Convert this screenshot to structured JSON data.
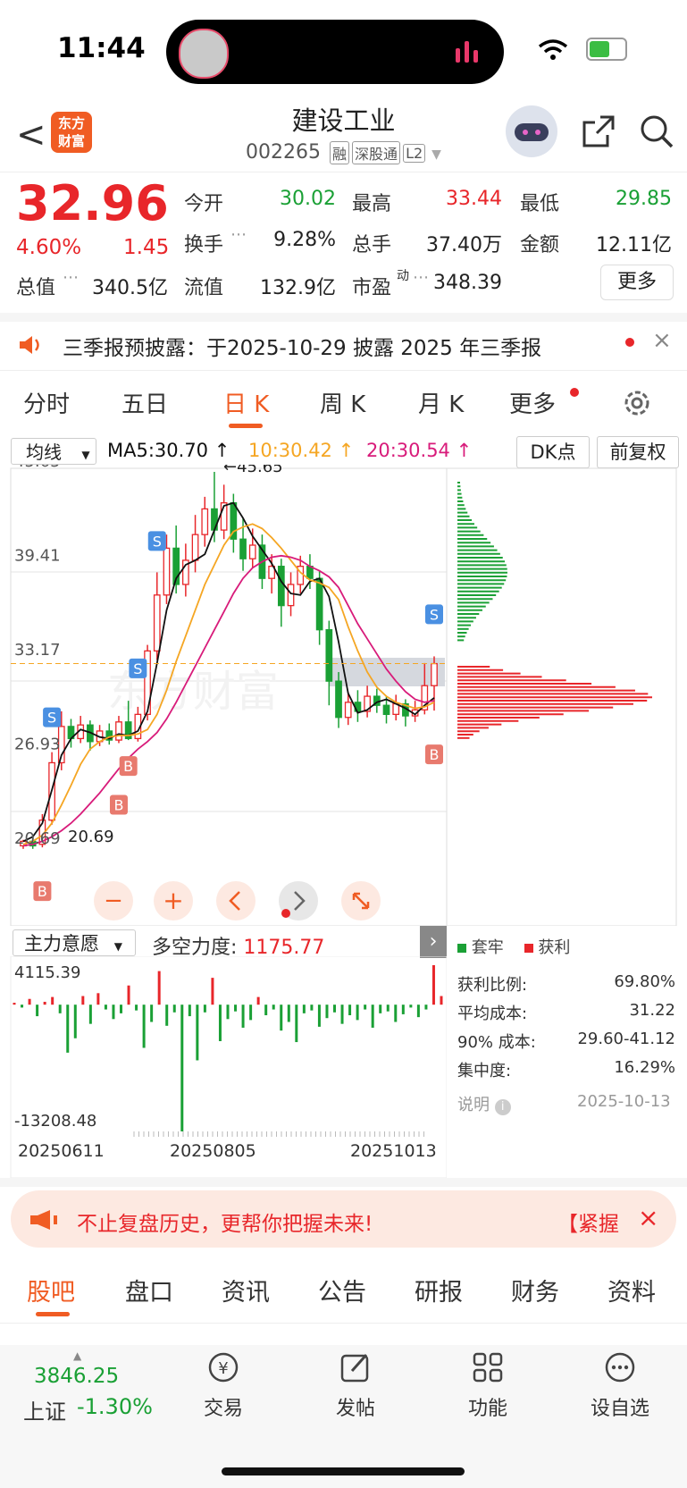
{
  "status_bar": {
    "time": "11:44"
  },
  "header": {
    "back_glyph": "<",
    "logo_line1": "东方",
    "logo_line2": "财富",
    "stock_name": "建设工业",
    "stock_code": "002265",
    "tags": [
      "融",
      "深股通",
      "L2"
    ]
  },
  "quote": {
    "price": "32.96",
    "change_pct": "4.60%",
    "change": "1.45",
    "fields": [
      {
        "label": "今开",
        "value": "30.02",
        "color": "#1aa035"
      },
      {
        "label": "最高",
        "value": "33.44",
        "color": "#e8262a"
      },
      {
        "label": "最低",
        "value": "29.85",
        "color": "#1aa035"
      },
      {
        "label": "换手",
        "value": "9.28%",
        "color": "#222222"
      },
      {
        "label": "总手",
        "value": "37.40万",
        "color": "#222222"
      },
      {
        "label": "金额",
        "value": "12.11亿",
        "color": "#222222"
      },
      {
        "label": "总值",
        "value": "340.5亿",
        "color": "#222222"
      },
      {
        "label": "流值",
        "value": "132.9亿",
        "color": "#222222"
      },
      {
        "label": "市盈",
        "value": "348.39",
        "color": "#222222"
      }
    ],
    "pe_superscript": "动",
    "more_label": "更多"
  },
  "notice": {
    "text": "三季报预披露：于2025-10-29 披露 2025 年三季报",
    "close": "×"
  },
  "kline_tabs": [
    "分时",
    "五日",
    "日 K",
    "周 K",
    "月 K",
    "更多"
  ],
  "chart_toolbar": {
    "indicator": "均线",
    "ma5": "MA5:30.70 ↑",
    "ma10": "10:30.42 ↑",
    "ma20": "20:30.54 ↑",
    "dk_label": "DK点",
    "adjust_label": "前复权"
  },
  "chart_data": [
    {
      "type": "candlestick",
      "title": "",
      "y_ticks": [
        "45.65",
        "39.41",
        "33.17",
        "26.93",
        "20.69"
      ],
      "ylim": [
        20.69,
        45.65
      ],
      "max_label": "←45.65",
      "min_label": "20.69",
      "current_price": 32.96,
      "x_ticks": [
        "20250611",
        "20250805",
        "20251013"
      ],
      "series": [
        {
          "name": "MA5",
          "color": "#111111",
          "values": [
            21.2,
            21.5,
            22.4,
            24.6,
            26.9,
            28.0,
            28.6,
            28.4,
            28.1,
            28.0,
            28.3,
            28.2,
            28.5,
            29.8,
            33.0,
            36.5,
            38.6,
            39.5,
            39.8,
            40.2,
            41.8,
            43.4,
            43.6,
            42.6,
            41.4,
            40.5,
            39.6,
            38.4,
            37.6,
            37.5,
            38.4,
            38.6,
            37.4,
            34.4,
            31.0,
            29.7,
            29.9,
            30.4,
            30.6,
            30.3,
            30.0,
            29.6,
            30.2,
            30.7
          ]
        },
        {
          "name": "MA10",
          "color": "#f5a623",
          "values": [
            21.0,
            21.2,
            21.6,
            22.4,
            23.6,
            24.9,
            26.3,
            27.3,
            27.8,
            28.1,
            28.2,
            28.2,
            28.3,
            28.6,
            29.6,
            31.2,
            33.1,
            34.8,
            36.5,
            38.2,
            39.5,
            40.8,
            41.7,
            42.0,
            42.2,
            41.9,
            41.3,
            40.6,
            39.8,
            39.0,
            38.5,
            38.3,
            38.0,
            37.2,
            35.4,
            33.8,
            32.4,
            31.4,
            30.8,
            30.4,
            30.2,
            30.0,
            30.1,
            30.4
          ]
        },
        {
          "name": "MA20",
          "color": "#d81b7a",
          "values": [
            20.9,
            21.0,
            21.2,
            21.5,
            21.9,
            22.4,
            23.0,
            23.7,
            24.4,
            25.2,
            26.0,
            26.7,
            27.3,
            27.8,
            28.4,
            29.3,
            30.4,
            31.6,
            32.8,
            34.0,
            35.2,
            36.4,
            37.6,
            38.6,
            39.3,
            39.7,
            40.0,
            40.1,
            40.0,
            39.8,
            39.4,
            39.1,
            38.7,
            38.0,
            36.8,
            35.6,
            34.6,
            33.6,
            32.6,
            31.8,
            31.1,
            30.6,
            30.4,
            30.5
          ]
        }
      ],
      "candles": [
        [
          20.9,
          21.2,
          20.7,
          21.3
        ],
        [
          21.2,
          20.9,
          20.7,
          21.4
        ],
        [
          21.0,
          22.6,
          20.8,
          23.0
        ],
        [
          22.6,
          26.4,
          22.3,
          27.1
        ],
        [
          26.4,
          28.8,
          25.9,
          29.8
        ],
        [
          28.8,
          28.0,
          27.4,
          29.3
        ],
        [
          28.0,
          28.9,
          27.7,
          29.5
        ],
        [
          28.9,
          27.8,
          27.2,
          29.2
        ],
        [
          27.8,
          28.5,
          27.5,
          28.9
        ],
        [
          28.5,
          27.9,
          27.6,
          29.0
        ],
        [
          27.9,
          29.1,
          27.7,
          29.5
        ],
        [
          29.1,
          28.0,
          27.9,
          30.5
        ],
        [
          28.0,
          29.6,
          27.8,
          30.1
        ],
        [
          29.6,
          33.8,
          29.2,
          34.2
        ],
        [
          33.8,
          37.5,
          33.2,
          39.0
        ],
        [
          37.5,
          40.6,
          36.9,
          41.5
        ],
        [
          40.6,
          38.2,
          37.6,
          42.1
        ],
        [
          38.2,
          39.8,
          37.4,
          40.9
        ],
        [
          39.8,
          41.5,
          39.0,
          42.8
        ],
        [
          41.5,
          43.2,
          40.7,
          44.0
        ],
        [
          43.2,
          41.8,
          41.0,
          45.65
        ],
        [
          41.8,
          43.6,
          41.2,
          44.8
        ],
        [
          43.6,
          41.2,
          40.3,
          44.2
        ],
        [
          41.2,
          39.9,
          39.1,
          42.6
        ],
        [
          39.9,
          40.8,
          39.3,
          41.9
        ],
        [
          40.8,
          38.6,
          37.9,
          41.5
        ],
        [
          38.6,
          39.4,
          37.6,
          40.2
        ],
        [
          39.4,
          36.8,
          35.4,
          39.9
        ],
        [
          36.8,
          38.2,
          36.1,
          39.0
        ],
        [
          38.2,
          39.4,
          37.6,
          40.1
        ],
        [
          39.4,
          38.6,
          37.9,
          40.2
        ],
        [
          38.6,
          35.2,
          34.2,
          39.1
        ],
        [
          35.2,
          31.8,
          30.2,
          35.8
        ],
        [
          31.8,
          29.4,
          28.7,
          32.4
        ],
        [
          29.4,
          30.4,
          28.9,
          31.1
        ],
        [
          30.4,
          29.8,
          29.1,
          31.2
        ],
        [
          29.8,
          30.8,
          29.4,
          31.5
        ],
        [
          30.8,
          30.2,
          29.7,
          31.3
        ],
        [
          30.2,
          29.6,
          29.0,
          30.8
        ],
        [
          29.6,
          30.3,
          29.2,
          30.9
        ],
        [
          30.3,
          29.5,
          28.8,
          30.6
        ],
        [
          29.5,
          29.9,
          29.1,
          30.5
        ],
        [
          29.9,
          31.5,
          29.6,
          33.0
        ],
        [
          31.5,
          32.96,
          29.85,
          33.44
        ]
      ],
      "signals": [
        "S",
        "S",
        "S",
        "S",
        "B",
        "B",
        "B",
        "B"
      ]
    },
    {
      "type": "bar",
      "title": "",
      "indicator": "主力意愿",
      "label": "多空力度:",
      "value": "1175.77",
      "y_ticks": [
        "4115.39",
        "-13208.48"
      ],
      "ylim": [
        -13208.48,
        4115.39
      ],
      "values": [
        200,
        -300,
        600,
        -1200,
        300,
        800,
        -900,
        -5000,
        -3500,
        900,
        -2000,
        1200,
        -500,
        -1500,
        -900,
        2000,
        -600,
        -4500,
        -1800,
        3500,
        -2200,
        -800,
        -13208,
        -1200,
        -5800,
        -800,
        2800,
        -3800,
        -1500,
        -700,
        -2400,
        -1600,
        800,
        -1100,
        -500,
        -2700,
        -1800,
        -3900,
        -900,
        -600,
        -2300,
        -1400,
        -800,
        -2000,
        -1100,
        -1600,
        -500,
        -2400,
        -900,
        -700,
        -1800,
        -1000,
        -300,
        -1300,
        -500,
        4115,
        900
      ]
    }
  ],
  "chip": {
    "legend_locked": "套牢",
    "legend_profit": "获利",
    "rows": [
      {
        "label": "获利比例:",
        "value": "69.80%"
      },
      {
        "label": "平均成本:",
        "value": "31.22"
      },
      {
        "label": "90% 成本:",
        "value": "29.60-41.12"
      },
      {
        "label": "集中度:",
        "value": "16.29%"
      }
    ],
    "explain": "说明",
    "date": "2025-10-13"
  },
  "banner": {
    "text": "不止复盘历史，更帮你把握未来!",
    "right": "【紧握",
    "close": "×"
  },
  "bottom_tabs": [
    "股吧",
    "盘口",
    "资讯",
    "公告",
    "研报",
    "财务",
    "资料"
  ],
  "bottom_nav": {
    "index_value": "3846.25",
    "index_name": "上证",
    "index_change": "-1.30%",
    "items": [
      "交易",
      "发帖",
      "功能",
      "设自选"
    ]
  }
}
